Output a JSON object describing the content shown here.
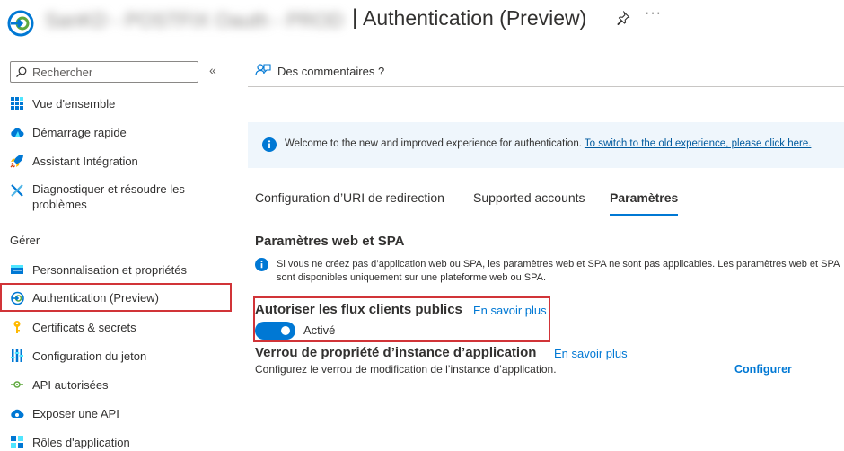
{
  "header": {
    "app_name": "SanKD - POSTFIX Oauth - PROD",
    "separator": "|",
    "page_title": "Authentication (Preview)",
    "more": "···"
  },
  "sidebar": {
    "search_placeholder": "Rechercher",
    "collapse": "«",
    "top_items": [
      {
        "label": "Vue d'ensemble",
        "icon": "grid-icon"
      },
      {
        "label": "Démarrage rapide",
        "icon": "cloud-icon"
      },
      {
        "label": "Assistant Intégration",
        "icon": "rocket-icon"
      },
      {
        "label": "Diagnostiquer et résoudre les problèmes",
        "icon": "wrench-icon"
      }
    ],
    "group_label": "Gérer",
    "manage_items": [
      {
        "label": "Personnalisation et propriétés",
        "icon": "branding-icon"
      },
      {
        "label": "Authentication (Preview)",
        "icon": "auth-icon",
        "active": true
      },
      {
        "label": "Certificats & secrets",
        "icon": "key-icon"
      },
      {
        "label": "Configuration du jeton",
        "icon": "token-icon"
      },
      {
        "label": "API autorisées",
        "icon": "api-icon"
      },
      {
        "label": "Exposer une API",
        "icon": "cloud-api-icon"
      },
      {
        "label": "Rôles d'application",
        "icon": "roles-icon"
      }
    ]
  },
  "commandbar": {
    "feedback_label": "Des commentaires ?"
  },
  "banner": {
    "text": "Welcome to the new and improved experience for authentication. ",
    "link": "To switch to the old experience, please click here."
  },
  "tabs": [
    {
      "label": "Configuration d’URI de redirection",
      "selected": false
    },
    {
      "label": "Supported accounts",
      "selected": false
    },
    {
      "label": "Paramètres",
      "selected": true
    }
  ],
  "web_spa": {
    "title": "Paramètres web et SPA",
    "info": "Si vous ne créez pas d’application web ou SPA, les paramètres web et SPA ne sont pas applicables. Les paramètres web et SPA sont disponibles uniquement sur une plateforme web ou SPA."
  },
  "public_flows": {
    "title": "Autoriser les flux clients publics",
    "learn_more": "En savoir plus",
    "toggle_state": "Activé",
    "enabled": true
  },
  "instance_lock": {
    "title": "Verrou de propriété d’instance d’application",
    "learn_more": "En savoir plus",
    "description": "Configurez le verrou de modification de l’instance d’application.",
    "configure_label": "Configurer"
  },
  "colors": {
    "accent": "#0078d4",
    "highlight": "#d13438",
    "banner_bg": "#eff6fc"
  }
}
